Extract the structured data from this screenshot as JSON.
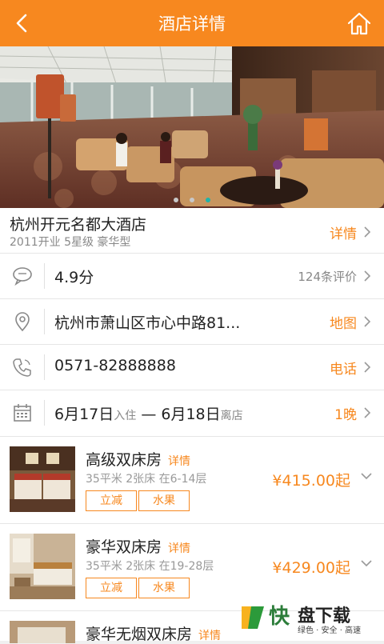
{
  "header": {
    "title": "酒店详情"
  },
  "gallery": {
    "slides": 3,
    "active_slide": 3
  },
  "hotel": {
    "name": "杭州开元名都大酒店",
    "meta": "2011开业  5星级  豪华型",
    "detail_link": "详情"
  },
  "rating": {
    "score": "4.9分",
    "reviews": "124条评价"
  },
  "address": {
    "text": "杭州市萧山区市心中路81...",
    "link": "地图"
  },
  "phone": {
    "number": "0571-82888888",
    "link": "电话"
  },
  "dates": {
    "checkin": "6月17日",
    "checkin_label": "入住",
    "dash": "—",
    "checkout": "6月18日",
    "checkout_label": "离店",
    "nights": "1晚"
  },
  "rooms": [
    {
      "name": "高级双床房",
      "detail": "详情",
      "spec": "35平米 2张床 在6-14层",
      "tags": [
        "立减",
        "水果"
      ],
      "price": "¥415.00起"
    },
    {
      "name": "豪华双床房",
      "detail": "详情",
      "spec": "35平米 2张床 在19-28层",
      "tags": [
        "立减",
        "水果"
      ],
      "price": "¥429.00起"
    },
    {
      "name": "豪华无烟双床房",
      "detail": "详情"
    }
  ],
  "watermark": {
    "char": "快",
    "brand": "盘下载",
    "slogan": "绿色 · 安全 · 高速"
  },
  "colors": {
    "accent": "#f7881f",
    "active_dot": "#20b3a8"
  }
}
